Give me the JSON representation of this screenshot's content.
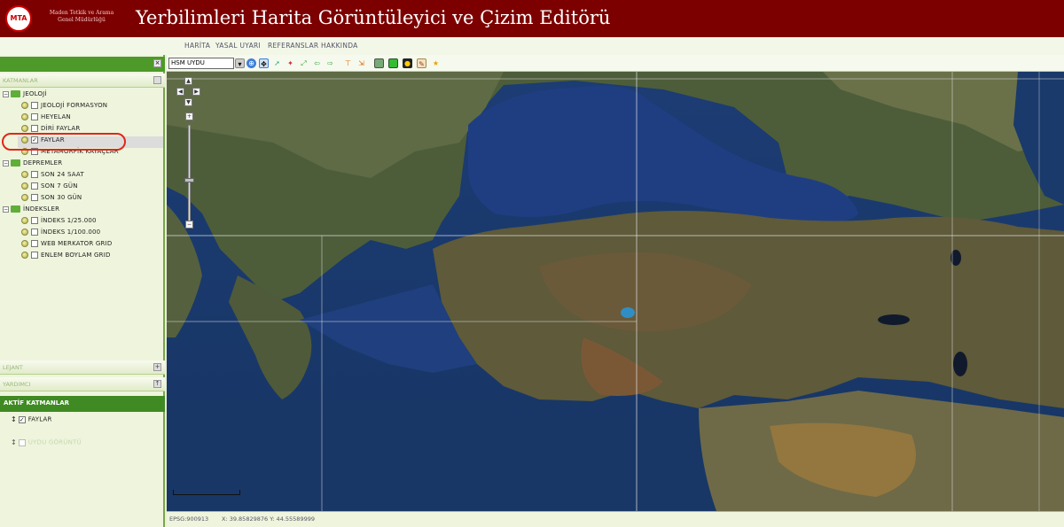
{
  "header": {
    "logo_text": "MTA",
    "org_name_line1": "Maden Tetkik ve Arama",
    "org_name_line2": "Genel Müdürlüğü",
    "title": "Yerbilimleri Harita Görüntüleyici ve Çizim Editörü"
  },
  "menu": {
    "items": [
      "HARİTA",
      "YASAL UYARI",
      "REFERANSLAR",
      "HAKKINDA"
    ]
  },
  "left_panel": {
    "close_icon_glyph": "×",
    "layers_header": "KATMANLAR",
    "tree": [
      {
        "label": "JEOLOJİ",
        "type": "group"
      },
      {
        "label": "JEOLOJİ FORMASYON",
        "type": "layer",
        "checked": false
      },
      {
        "label": "HEYELAN",
        "type": "layer",
        "checked": false
      },
      {
        "label": "DİRİ FAYLAR",
        "type": "layer",
        "checked": false
      },
      {
        "label": "FAYLAR",
        "type": "layer",
        "checked": true
      },
      {
        "label": "METAMORFİK KAYAÇLAR",
        "type": "layer",
        "checked": false
      },
      {
        "label": "DEPREMLER",
        "type": "group"
      },
      {
        "label": "SON 24 SAAT",
        "type": "layer",
        "checked": false
      },
      {
        "label": "SON 7 GÜN",
        "type": "layer",
        "checked": false
      },
      {
        "label": "SON 30 GÜN",
        "type": "layer",
        "checked": false
      },
      {
        "label": "İNDEKSLER",
        "type": "group"
      },
      {
        "label": "İNDEKS 1/25.000",
        "type": "layer",
        "checked": false
      },
      {
        "label": "İNDEKS 1/100.000",
        "type": "layer",
        "checked": false
      },
      {
        "label": "WEB MERKATOR GRID",
        "type": "layer",
        "checked": false
      },
      {
        "label": "ENLEM BOYLAM GRID",
        "type": "layer",
        "checked": false
      }
    ],
    "legend_header": "LEJANT",
    "tools_header": "YARDIMCI",
    "active_header": "AKTİF KATMANLAR",
    "active_layers": [
      "FAYLAR"
    ],
    "active_second_placeholder": "UYDU GÖRÜNTÜ"
  },
  "toolbar": {
    "basemap_value": "HSM UYDU",
    "tools": [
      "zoom-in-icon",
      "pan-icon",
      "select-icon",
      "identify-icon",
      "zoom-extent-icon",
      "back-icon",
      "forward-icon",
      "measure-icon",
      "draw-icon",
      "print-icon",
      "export-icon",
      "info-icon",
      "edit-icon",
      "star-icon"
    ]
  },
  "status": {
    "projection": "EPSG:900913",
    "coords": "X: 39.85829876  Y: 44.55589999"
  },
  "colors": {
    "header_bg": "#7d0000",
    "panel_green": "#4d9a2a",
    "highlight_ring": "#e1261c"
  }
}
